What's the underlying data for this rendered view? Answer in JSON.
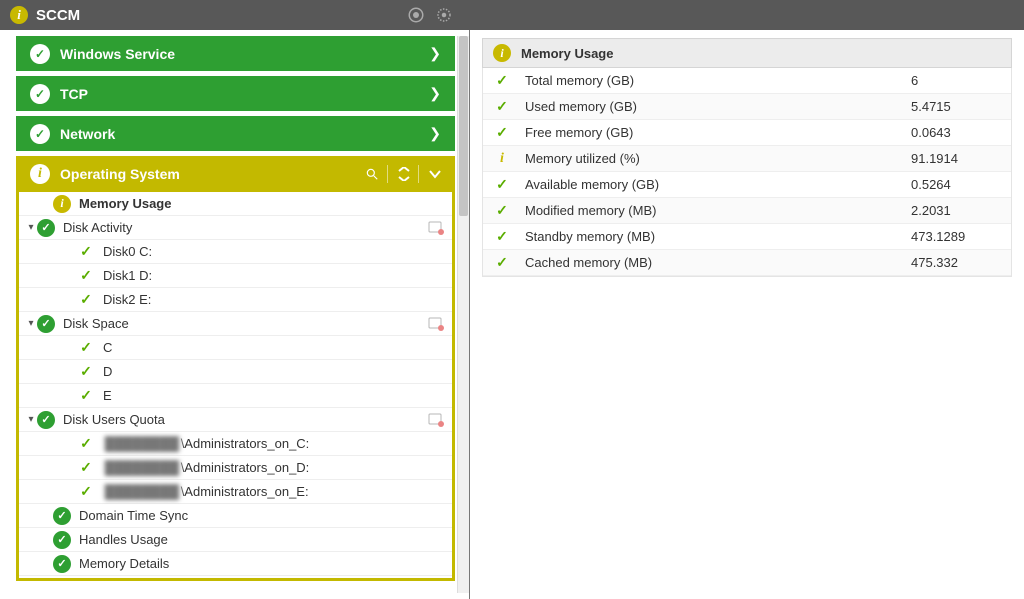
{
  "header": {
    "title": "SCCM"
  },
  "sidebar": {
    "groups": [
      {
        "label": "Windows Service"
      },
      {
        "label": "TCP"
      },
      {
        "label": "Network"
      }
    ],
    "active_group": {
      "label": "Operating System"
    },
    "tree": [
      {
        "label": "Memory Usage",
        "selected": true,
        "icon": "info",
        "depth": 0
      },
      {
        "label": "Disk Activity",
        "icon": "ok",
        "depth": 0,
        "expandable": true,
        "action": true
      },
      {
        "label": "Disk0 C:",
        "icon": "check",
        "depth": 1
      },
      {
        "label": "Disk1 D:",
        "icon": "check",
        "depth": 1
      },
      {
        "label": "Disk2 E:",
        "icon": "check",
        "depth": 1
      },
      {
        "label": "Disk Space",
        "icon": "ok",
        "depth": 0,
        "expandable": true,
        "action": true
      },
      {
        "label": "C",
        "icon": "check",
        "depth": 1
      },
      {
        "label": "D",
        "icon": "check",
        "depth": 1
      },
      {
        "label": "E",
        "icon": "check",
        "depth": 1
      },
      {
        "label": "Disk Users Quota",
        "icon": "ok",
        "depth": 0,
        "expandable": true,
        "action": true
      },
      {
        "label_prefix_redacted": true,
        "label": "\\Administrators_on_C:",
        "icon": "check",
        "depth": 1
      },
      {
        "label_prefix_redacted": true,
        "label": "\\Administrators_on_D:",
        "icon": "check",
        "depth": 1
      },
      {
        "label_prefix_redacted": true,
        "label": "\\Administrators_on_E:",
        "icon": "check",
        "depth": 1
      },
      {
        "label": "Domain Time Sync",
        "icon": "ok",
        "depth": 0
      },
      {
        "label": "Handles Usage",
        "icon": "ok",
        "depth": 0
      },
      {
        "label": "Memory Details",
        "icon": "ok",
        "depth": 0
      }
    ]
  },
  "detail": {
    "title": "Memory Usage",
    "rows": [
      {
        "status": "ok",
        "label": "Total memory (GB)",
        "value": "6"
      },
      {
        "status": "ok",
        "label": "Used memory (GB)",
        "value": "5.4715"
      },
      {
        "status": "ok",
        "label": "Free memory (GB)",
        "value": "0.0643"
      },
      {
        "status": "info",
        "label": "Memory utilized (%)",
        "value": "91.1914"
      },
      {
        "status": "ok",
        "label": "Available memory (GB)",
        "value": "0.5264"
      },
      {
        "status": "ok",
        "label": "Modified memory (MB)",
        "value": "2.2031"
      },
      {
        "status": "ok",
        "label": "Standby memory (MB)",
        "value": "473.1289"
      },
      {
        "status": "ok",
        "label": "Cached memory (MB)",
        "value": "475.332"
      }
    ]
  }
}
